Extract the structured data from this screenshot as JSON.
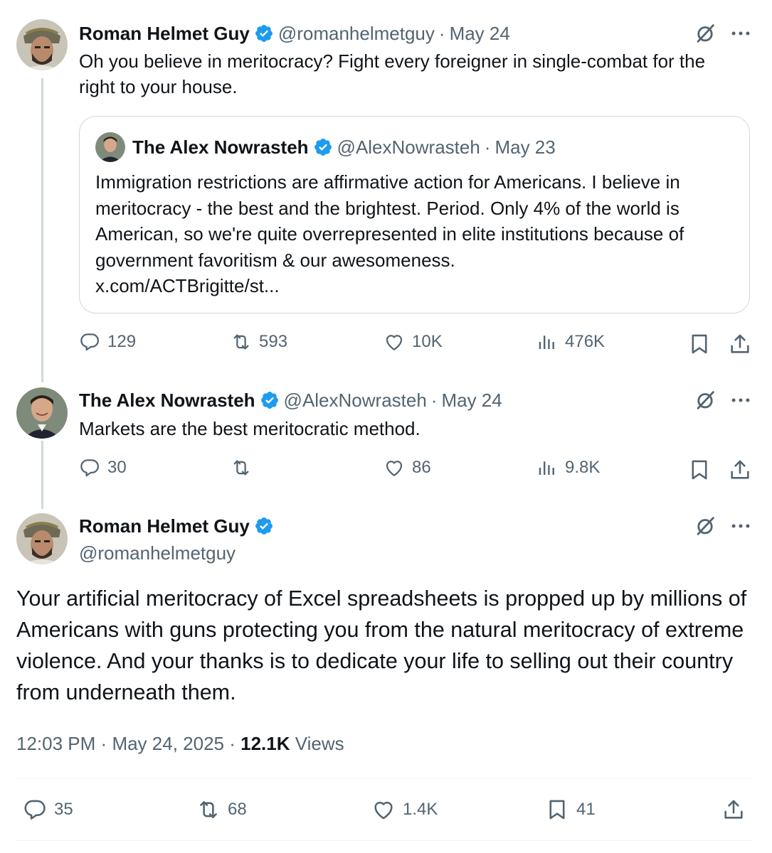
{
  "tweet1": {
    "name": "Roman Helmet Guy",
    "handle": "@romanhelmetguy",
    "sep": "·",
    "date": "May 24",
    "text": "Oh you believe in meritocracy? Fight every foreigner in single-combat for the right to your house.",
    "quote": {
      "name": "The Alex Nowrasteh",
      "handle": "@AlexNowrasteh",
      "sep": "·",
      "date": "May 23",
      "text": "Immigration restrictions are affirmative action for Americans. I believe in meritocracy - the best and the brightest. Period. Only 4% of the world is American, so we're quite overrepresented in elite institutions because of government favoritism & our awesomeness.",
      "link": "x.com/ACTBrigitte/st..."
    },
    "replies": "129",
    "reposts": "593",
    "likes": "10K",
    "views": "476K"
  },
  "tweet2": {
    "name": "The Alex Nowrasteh",
    "handle": "@AlexNowrasteh",
    "sep": "·",
    "date": "May 24",
    "text": "Markets are the best meritocratic method.",
    "replies": "30",
    "reposts": "",
    "likes": "86",
    "views": "9.8K"
  },
  "main": {
    "name": "Roman Helmet Guy",
    "handle": "@romanhelmetguy",
    "text": "Your artificial meritocracy of Excel spreadsheets is propped up by millions of Americans with guns protecting you from the natural meritocracy of extreme violence. And your thanks is to dedicate your life to selling out their country from underneath them.",
    "time": "12:03 PM",
    "sep": "·",
    "date": "May 24, 2025",
    "sep2": "·",
    "views_count": "12.1K",
    "views_label": "Views",
    "replies": "35",
    "reposts": "68",
    "likes": "1.4K",
    "bookmarks": "41"
  },
  "icons": {
    "more": "more-dots-icon",
    "grok": "grok-icon",
    "reply": "reply-icon",
    "repost": "repost-icon",
    "like": "like-icon",
    "views": "views-icon",
    "bookmark": "bookmark-icon",
    "share": "share-icon",
    "verified": "verified-badge-icon"
  },
  "colors": {
    "verified": "#1d9bf0",
    "muted": "#536471",
    "border": "#cfd9de"
  }
}
